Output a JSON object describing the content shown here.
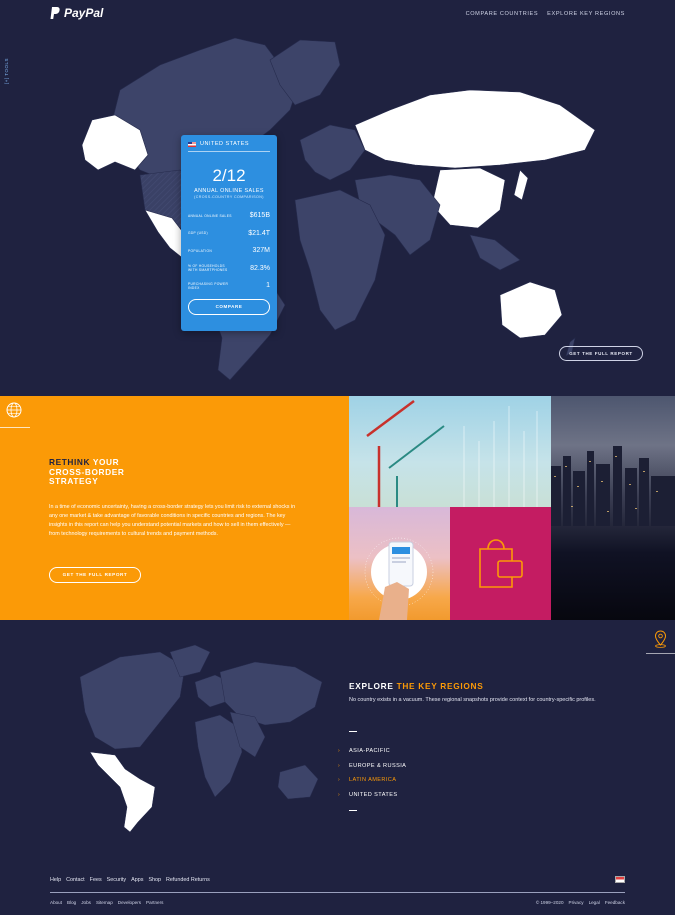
{
  "header": {
    "brand": "PayPal",
    "nav": [
      "COMPARE COUNTRIES",
      "EXPLORE KEY REGIONS"
    ],
    "side_tab": "[+] TOOLS"
  },
  "card": {
    "country": "UNITED STATES",
    "rank": "2/12",
    "rank_label": "ANNUAL ONLINE SALES",
    "rank_sub": "(CROSS-COUNTRY COMPARISON)",
    "stats": [
      {
        "label": "ANNUAL ONLINE SALES",
        "value": "$615B"
      },
      {
        "label": "GDP (USD)",
        "value": "$21.4T"
      },
      {
        "label": "POPULATION",
        "value": "327M"
      },
      {
        "label": "% OF HOUSEHOLDS WITH SMARTPHONES",
        "value": "82.3%"
      },
      {
        "label": "PURCHASING POWER INDEX",
        "value": "1"
      }
    ],
    "button": "COMPARE"
  },
  "hero_report_button": "GET THE FULL REPORT",
  "rethink": {
    "headline_w1": "RETHINK",
    "headline_w2": "YOUR",
    "headline_rest": "CROSS-BORDER STRATEGY",
    "body": "In a time of economic uncertainty, having a cross-border strategy lets you limit risk to external shocks in any one market & take advantage of favorable conditions in specific countries and regions. The key insights in this report can help you understand potential markets and how to sell in them effectively — from technology requirements to cultural trends and payment methods.",
    "button": "GET THE FULL REPORT"
  },
  "explore": {
    "title_w1": "EXPLORE",
    "title_hl": "THE KEY REGIONS",
    "desc": "No country exists in a vacuum. These regional snapshots provide context for country-specific profiles.",
    "regions": [
      {
        "label": "ASIA-PACIFIC",
        "active": false
      },
      {
        "label": "EUROPE & RUSSIA",
        "active": false
      },
      {
        "label": "LATIN AMERICA",
        "active": true
      },
      {
        "label": "UNITED STATES",
        "active": false
      }
    ]
  },
  "footer": {
    "top_links": [
      "Help",
      "Contact",
      "Fees",
      "Security",
      "Apps",
      "Shop",
      "Refunded Returns"
    ],
    "bottom_links": [
      "About",
      "Blog",
      "Jobs",
      "Sitemap",
      "Developers",
      "Partners"
    ],
    "legal": [
      "© 1999–2020",
      "Privacy",
      "Legal",
      "Feedback"
    ]
  },
  "colors": {
    "background": "#1f2240",
    "accent_orange": "#fb9a07",
    "card_blue": "#2d8fe0",
    "magenta": "#c41c62",
    "map_land": "#3d4469",
    "map_highlight": "#ffffff"
  }
}
